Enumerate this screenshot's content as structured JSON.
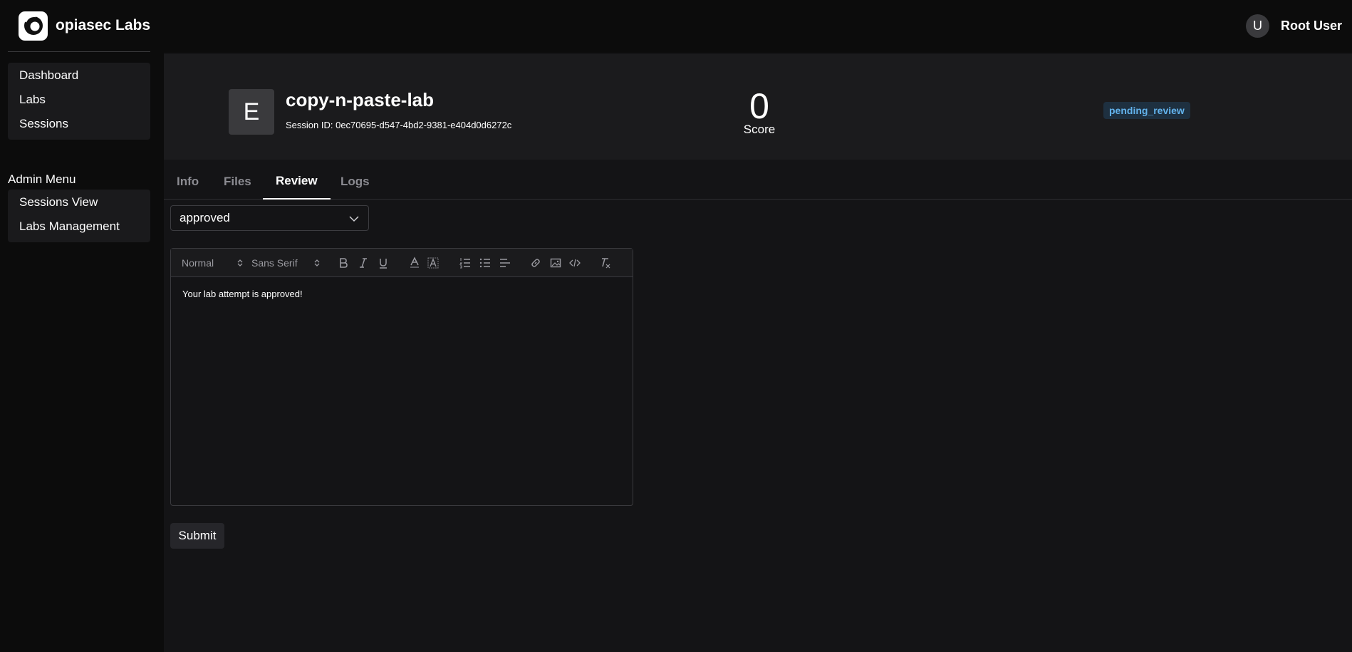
{
  "brand": {
    "name": "opiasec Labs"
  },
  "user": {
    "avatar_letter": "U",
    "name": "Root User"
  },
  "sidebar": {
    "items": [
      {
        "label": "Dashboard"
      },
      {
        "label": "Labs"
      },
      {
        "label": "Sessions"
      }
    ],
    "admin_title": "Admin Menu",
    "admin_items": [
      {
        "label": "Sessions View"
      },
      {
        "label": "Labs Management"
      }
    ]
  },
  "session": {
    "avatar_letter": "E",
    "title": "copy-n-paste-lab",
    "id_text": "Session ID: 0ec70695-d547-4bd2-9381-e404d0d6272c",
    "score_value": "0",
    "score_label": "Score",
    "status": "pending_review"
  },
  "tabs": [
    {
      "label": "Info",
      "active": false
    },
    {
      "label": "Files",
      "active": false
    },
    {
      "label": "Review",
      "active": true
    },
    {
      "label": "Logs",
      "active": false
    }
  ],
  "review": {
    "decision_selected": "approved",
    "editor": {
      "size_selected": "Normal",
      "font_selected": "Sans Serif",
      "content": "Your lab attempt is approved!"
    },
    "submit_label": "Submit"
  },
  "colors": {
    "badge_bg": "#1e3040",
    "badge_text": "#63b3ed",
    "panel_bg": "#1b1b1d"
  }
}
